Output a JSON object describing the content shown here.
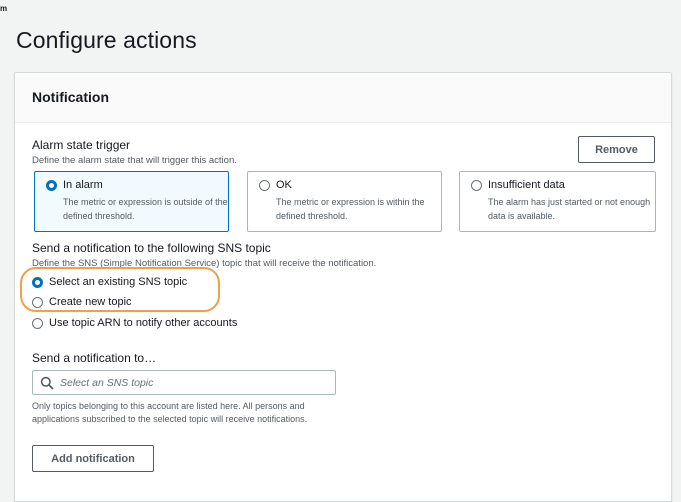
{
  "page": {
    "corner_mark": "m",
    "title": "Configure actions"
  },
  "notification": {
    "title": "Notification",
    "remove_label": "Remove",
    "alarm_state_trigger": {
      "label": "Alarm state trigger",
      "description": "Define the alarm state that will trigger this action.",
      "options": [
        {
          "title": "In alarm",
          "description": "The metric or expression is outside of the defined threshold.",
          "selected": true
        },
        {
          "title": "OK",
          "description": "The metric or expression is within the defined threshold.",
          "selected": false
        },
        {
          "title": "Insufficient data",
          "description": "The alarm has just started or not enough data is available.",
          "selected": false
        }
      ]
    },
    "sns_topic": {
      "label": "Send a notification to the following SNS topic",
      "description": "Define the SNS (Simple Notification Service) topic that will receive the notification.",
      "options": [
        {
          "label": "Select an existing SNS topic",
          "selected": true
        },
        {
          "label": "Create new topic",
          "selected": false
        },
        {
          "label": "Use topic ARN to notify other accounts",
          "selected": false
        }
      ],
      "highlight_color": "#f0a04b"
    },
    "send_to": {
      "label": "Send a notification to…",
      "placeholder": "Select an SNS topic",
      "value": "",
      "hint": "Only topics belonging to this account are listed here. All persons and applications subscribed to the selected topic will receive notifications."
    },
    "add_notification_label": "Add notification"
  },
  "colors": {
    "accent": "#0073bb",
    "page_background": "#f2f3f3",
    "highlight": "#f0a04b"
  }
}
